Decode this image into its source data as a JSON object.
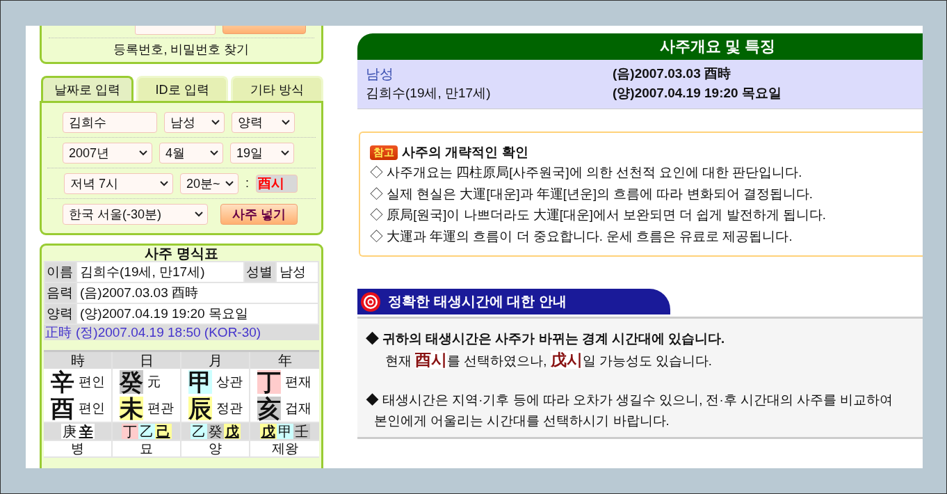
{
  "login": {
    "find_link": "등록번호, 비밀번호 찾기"
  },
  "input_tabs": [
    {
      "label": "날짜로 입력",
      "selected": true
    },
    {
      "label": "ID로 입력",
      "selected": false
    },
    {
      "label": "기타 방식",
      "selected": false
    }
  ],
  "form": {
    "name": "김희수",
    "gender": "남성",
    "calendar": "양력",
    "year": "2007년",
    "month": "4월",
    "day": "19일",
    "hour": "저녁 7시",
    "minute": "20분~",
    "separator": ":",
    "hour_branch": "酉시",
    "location": "한국 서울(-30분)",
    "submit_button": "사주 넣기"
  },
  "chart_table": {
    "title": "사주 명식표",
    "rows": [
      {
        "label": "이름",
        "value": "김희수(19세, 만17세)",
        "extra_label": "성별",
        "extra_value": "남성"
      },
      {
        "label": "음력",
        "value": "(음)2007.03.03 酉時"
      },
      {
        "label": "양력",
        "value": "(양)2007.04.19 19:20 목요일"
      }
    ],
    "true_time": {
      "label": "正時",
      "value": "(정)2007.04.19 18:50 (KOR-30)"
    },
    "pillars": [
      {
        "header": "時",
        "stem": {
          "char": "辛",
          "color": "#ffffff",
          "role": "편인"
        },
        "branch": {
          "char": "酉",
          "color": "#ffffff",
          "role": "편인"
        },
        "hidden_stems": [
          {
            "char": "庚",
            "color": "#ffffff",
            "underlined": false
          },
          {
            "char": "辛",
            "color": "#ffffff",
            "underlined": true
          }
        ],
        "stage": "병"
      },
      {
        "header": "日",
        "stem": {
          "char": "癸",
          "color": "#c8c8c8",
          "role": "元"
        },
        "branch": {
          "char": "未",
          "color": "#ffff99",
          "role": "편관"
        },
        "hidden_stems": [
          {
            "char": "丁",
            "color": "#ffcccc",
            "underlined": false
          },
          {
            "char": "乙",
            "color": "#ccffff",
            "underlined": false
          },
          {
            "char": "己",
            "color": "#ffff99",
            "underlined": true
          }
        ],
        "stage": "묘"
      },
      {
        "header": "月",
        "stem": {
          "char": "甲",
          "color": "#ccffff",
          "role": "상관"
        },
        "branch": {
          "char": "辰",
          "color": "#ffff99",
          "role": "정관"
        },
        "hidden_stems": [
          {
            "char": "乙",
            "color": "#ccffff",
            "underlined": false
          },
          {
            "char": "癸",
            "color": "#c8c8c8",
            "underlined": false
          },
          {
            "char": "戊",
            "color": "#ffff99",
            "underlined": true
          }
        ],
        "stage": "양"
      },
      {
        "header": "年",
        "stem": {
          "char": "丁",
          "color": "#ffcccc",
          "role": "편재"
        },
        "branch": {
          "char": "亥",
          "color": "#c8c8c8",
          "role": "겁재"
        },
        "hidden_stems": [
          {
            "char": "戊",
            "color": "#ffff99",
            "underlined": true
          },
          {
            "char": "甲",
            "color": "#ccffff",
            "underlined": false
          },
          {
            "char": "壬",
            "color": "#c8c8c8",
            "underlined": false
          }
        ],
        "stage": "제왕"
      }
    ]
  },
  "summary": {
    "title": "사주개요 및 특징",
    "gender": "남성",
    "name_age": "김희수(19세, 만17세)",
    "lunar": "(음)2007.03.03 酉時",
    "solar": "(양)2007.04.19 19:20 목요일"
  },
  "note": {
    "badge": "참고",
    "title": "사주의 개략적인 확인",
    "lines": [
      "◇ 사주개요는 四柱原局[사주원국]에 의한 선천적 요인에 대한 판단입니다.",
      "◇ 실제 현실은 大運[대운]과 年運[년운]의 흐름에 따라 변화되어 결정됩니다.",
      "◇ 原局[원국]이 나쁘더라도 大運[대운]에서 보완되면 더 쉽게 발전하게 됩니다.",
      "◇ 大運과 年運의 흐름이 더 중요합니다. 운세 흐름은 유료로 제공됩니다."
    ]
  },
  "birth_time": {
    "title": "정확한 태생시간에 대한 안내",
    "paragraphs": [
      {
        "kind": "bold",
        "text": "◆ 귀하의 태생시간은 사주가 바뀌는 경계 시간대에 있습니다."
      },
      {
        "kind": "indented",
        "text": "현재 **酉시**를 선택하였으나, **戊시**일 가능성도 있습니다."
      },
      {
        "kind": "hanging",
        "text": "◆ 태생시간은 지역·기후 등에 따라 오차가 생길수 있으니, 전·후 시간대의 사주를 비교하여 본인에게 어울리는 시간대를 선택하시기 바랍니다."
      }
    ]
  }
}
